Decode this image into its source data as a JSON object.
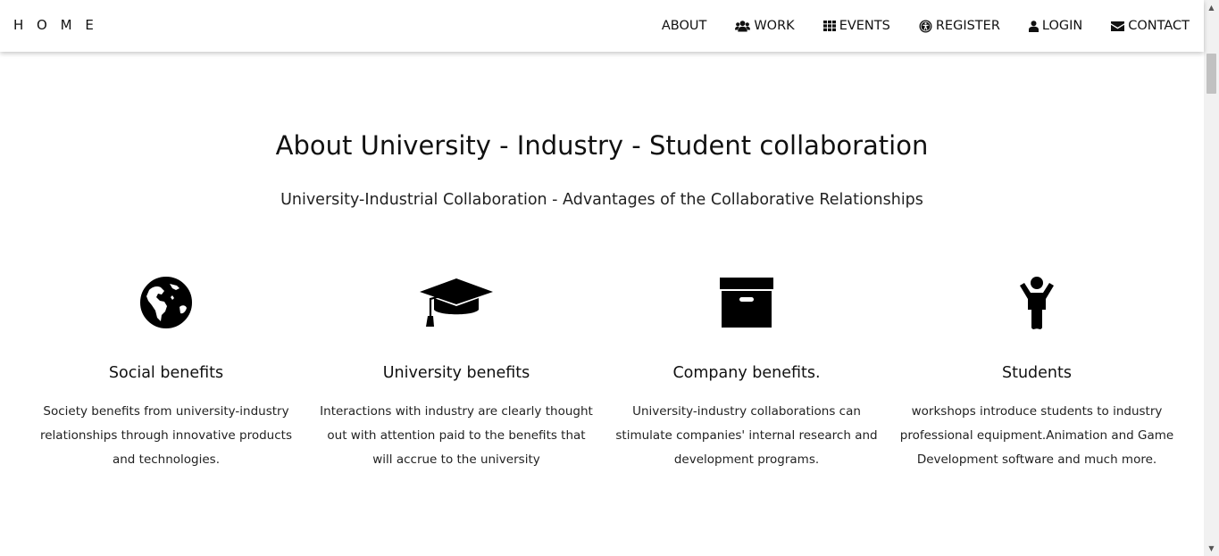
{
  "nav": {
    "brand": "H O M E",
    "links": [
      {
        "label": "ABOUT",
        "icon": ""
      },
      {
        "label": "WORK",
        "icon": "users-icon"
      },
      {
        "label": "EVENTS",
        "icon": "grid-icon"
      },
      {
        "label": "REGISTER",
        "icon": "accessibility-icon"
      },
      {
        "label": "LOGIN",
        "icon": "user-icon"
      },
      {
        "label": "CONTACT",
        "icon": "envelope-icon"
      }
    ]
  },
  "main": {
    "title": "About University - Industry - Student collaboration",
    "subtitle": "University-Industrial Collaboration - Advantages of the Collaborative Relationships"
  },
  "features": [
    {
      "icon": "globe-icon",
      "title": "Social benefits",
      "text": "Society benefits from university-industry relationships through innovative products and technologies."
    },
    {
      "icon": "graduation-cap-icon",
      "title": "University benefits",
      "text": "Interactions with industry are clearly thought out with attention paid to the benefits that will accrue to the university"
    },
    {
      "icon": "archive-icon",
      "title": "Company benefits.",
      "text": "University-industry collaborations can stimulate companies' internal research and development programs."
    },
    {
      "icon": "child-icon",
      "title": "Students",
      "text": "workshops introduce students to industry professional equipment.Animation and Game Development software and much more."
    }
  ],
  "colors": {
    "text": "#111111",
    "background": "#ffffff",
    "navbar": "#ffffff",
    "scrollbar_thumb": "#c1c1c1"
  }
}
